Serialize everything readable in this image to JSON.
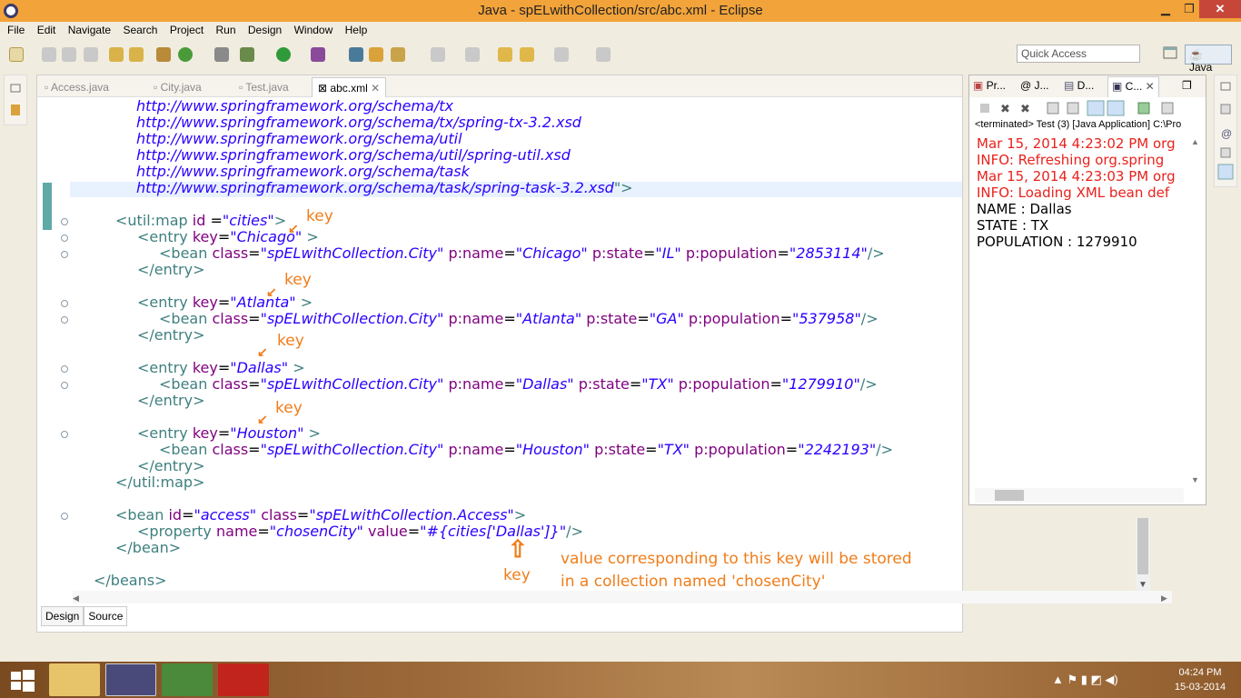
{
  "window": {
    "title": "Java - spELwithCollection/src/abc.xml - Eclipse",
    "minimize": "▁",
    "maximize": "❐",
    "close": "✕"
  },
  "menu": [
    "File",
    "Edit",
    "Navigate",
    "Search",
    "Project",
    "Run",
    "Design",
    "Window",
    "Help"
  ],
  "toolbar": {
    "quick_access_placeholder": "Quick Access",
    "perspective_label": "Java"
  },
  "editor": {
    "tabs": [
      "Access.java",
      "City.java",
      "Test.java",
      "abc.xml"
    ],
    "active_tab": "abc.xml",
    "bottom_tabs": [
      "Design",
      "Source"
    ],
    "active_bottom_tab": "Source"
  },
  "annotations": {
    "key_labels": [
      "key",
      "key",
      "key",
      "key",
      "key"
    ],
    "note_line1": "value corresponding to this key will be stored",
    "note_line2": "in a collection named 'chosenCity'"
  },
  "panel": {
    "tabs": [
      "Pr...",
      "@ J...",
      "D...",
      "C..."
    ],
    "terminated": "<terminated> Test (3) [Java Application] C:\\Pro",
    "console_lines": [
      {
        "text": "Mar 15, 2014 4:23:02 PM org",
        "kind": "err"
      },
      {
        "text": "INFO: Refreshing org.spring",
        "kind": "err"
      },
      {
        "text": "Mar 15, 2014 4:23:03 PM org",
        "kind": "err"
      },
      {
        "text": "INFO: Loading XML bean def",
        "kind": "err"
      },
      {
        "text": "NAME : Dallas",
        "kind": "out"
      },
      {
        "text": "STATE : TX",
        "kind": "out"
      },
      {
        "text": "POPULATION : 1279910",
        "kind": "out"
      }
    ]
  },
  "taskbar": {
    "time": "04:24 PM",
    "date": "15-03-2014"
  },
  "colors": {
    "titlebar": "#f2a33a",
    "tag": "#3f7f7f",
    "attribute": "#7f007f",
    "value": "#2a00ff",
    "annotation": "#f07d1a",
    "console_error": "#e8221c"
  }
}
